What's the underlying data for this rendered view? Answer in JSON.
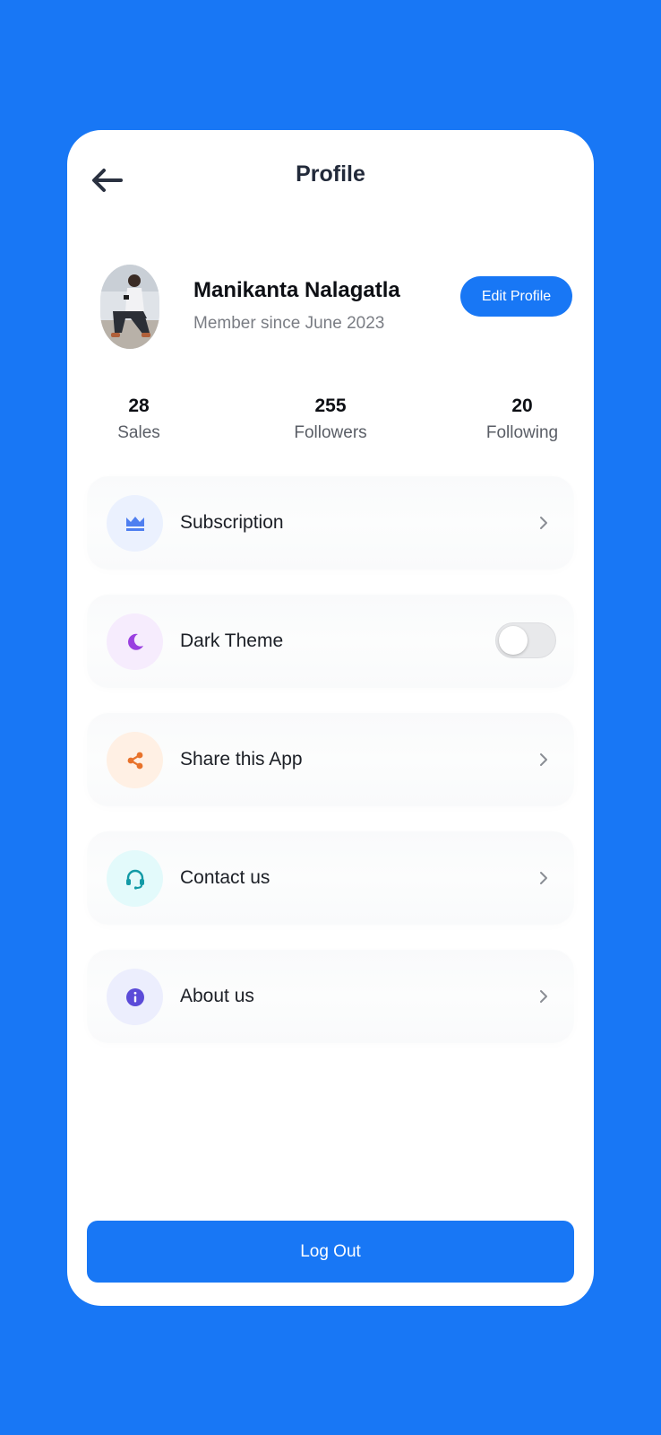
{
  "header": {
    "title": "Profile",
    "back_icon": "arrow-left-icon"
  },
  "profile": {
    "name": "Manikanta Nalagatla",
    "member_since": "Member since June 2023",
    "edit_label": "Edit Profile"
  },
  "stats": [
    {
      "value": "28",
      "label": "Sales"
    },
    {
      "value": "255",
      "label": "Followers"
    },
    {
      "value": "20",
      "label": "Following"
    }
  ],
  "menu": [
    {
      "label": "Subscription",
      "icon": "crown-icon",
      "icon_color": "#4f7ff0",
      "icon_bg": "#ebf1fe",
      "trailing": "chevron"
    },
    {
      "label": "Dark Theme",
      "icon": "moon-icon",
      "icon_color": "#9a3fe0",
      "icon_bg": "#f6ecfd",
      "trailing": "toggle",
      "toggle_on": false
    },
    {
      "label": "Share this App",
      "icon": "share-icon",
      "icon_color": "#e8722a",
      "icon_bg": "#fff0e4",
      "trailing": "chevron"
    },
    {
      "label": "Contact us",
      "icon": "headset-icon",
      "icon_color": "#139aa6",
      "icon_bg": "#e3fafb",
      "trailing": "chevron"
    },
    {
      "label": "About us",
      "icon": "info-icon",
      "icon_color": "#5b4bd8",
      "icon_bg": "#eceefd",
      "trailing": "chevron"
    }
  ],
  "logout_label": "Log Out",
  "colors": {
    "accent": "#1877f5",
    "background": "#1877f5",
    "card": "#ffffff"
  }
}
